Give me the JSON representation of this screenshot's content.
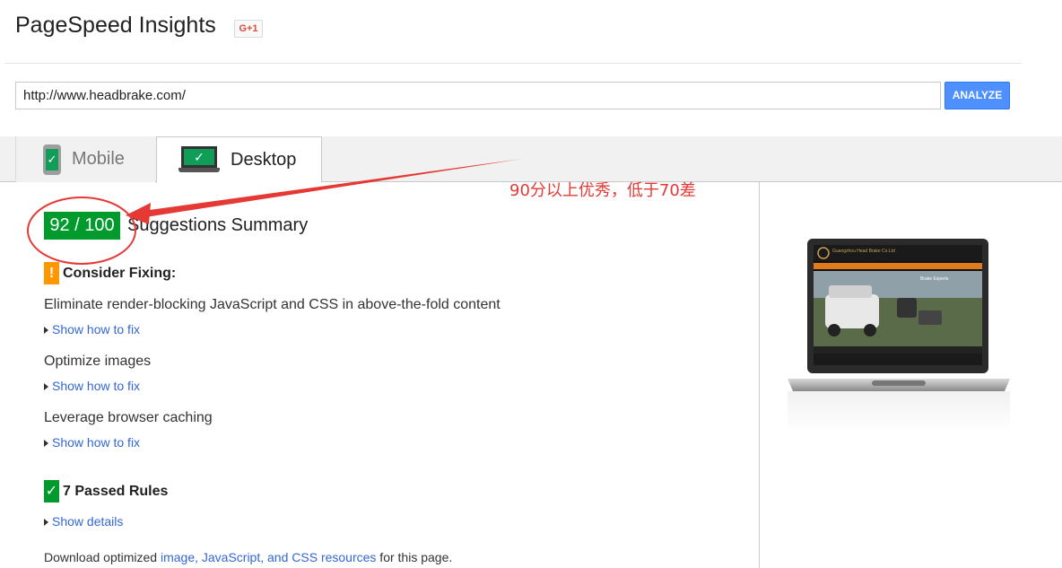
{
  "app": {
    "title": "PageSpeed Insights",
    "gplus_label": "G+1"
  },
  "search": {
    "url": "http://www.headbrake.com/",
    "analyze_label": "ANALYZE"
  },
  "tabs": [
    {
      "label": "Mobile",
      "active": false
    },
    {
      "label": "Desktop",
      "active": true
    }
  ],
  "score": {
    "value": "92 / 100",
    "summary_title": "Suggestions Summary",
    "color": "#009a2d"
  },
  "annotation": {
    "text": "90分以上优秀，低于70差",
    "color": "#e53935"
  },
  "consider_fixing": {
    "badge": "!",
    "title": "Consider Fixing:",
    "items": [
      {
        "label": "Eliminate render-blocking JavaScript and CSS in above-the-fold content",
        "link": "Show how to fix"
      },
      {
        "label": "Optimize images",
        "link": "Show how to fix"
      },
      {
        "label": "Leverage browser caching",
        "link": "Show how to fix"
      }
    ]
  },
  "passed": {
    "badge": "✓",
    "title": "7 Passed Rules",
    "link": "Show details"
  },
  "download": {
    "prefix": "Download optimized ",
    "link": "image, JavaScript, and CSS resources",
    "suffix": " for this page."
  },
  "preview": {
    "site_title": "Guangzhou Head Brake Co.Ltd",
    "banner_text": "Brake Experts"
  }
}
